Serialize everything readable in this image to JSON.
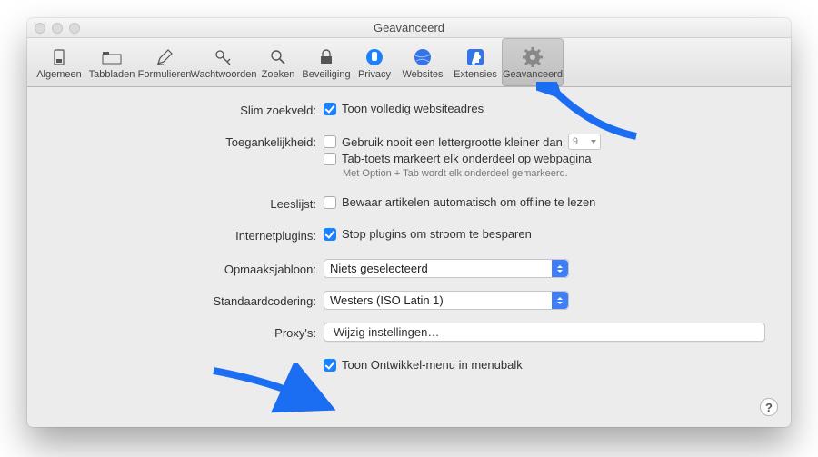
{
  "window": {
    "title": "Geavanceerd"
  },
  "tabs": [
    {
      "label": "Algemeen"
    },
    {
      "label": "Tabbladen"
    },
    {
      "label": "Formulieren"
    },
    {
      "label": "Wachtwoorden"
    },
    {
      "label": "Zoeken"
    },
    {
      "label": "Beveiliging"
    },
    {
      "label": "Privacy"
    },
    {
      "label": "Websites"
    },
    {
      "label": "Extensies"
    },
    {
      "label": "Geavanceerd"
    }
  ],
  "form": {
    "smartSearch": {
      "label": "Slim zoekveld:",
      "opt1": "Toon volledig websiteadres"
    },
    "accessibility": {
      "label": "Toegankelijkheid:",
      "opt1": "Gebruik nooit een lettergrootte kleiner dan",
      "fontsize": "9",
      "opt2": "Tab-toets markeert elk onderdeel op webpagina",
      "hint": "Met Option + Tab wordt elk onderdeel gemarkeerd."
    },
    "readingList": {
      "label": "Leeslijst:",
      "opt1": "Bewaar artikelen automatisch om offline te lezen"
    },
    "plugins": {
      "label": "Internetplugins:",
      "opt1": "Stop plugins om stroom te besparen"
    },
    "stylesheet": {
      "label": "Opmaaksjabloon:",
      "value": "Niets geselecteerd"
    },
    "encoding": {
      "label": "Standaardcodering:",
      "value": "Westers (ISO Latin 1)"
    },
    "proxy": {
      "label": "Proxy's:",
      "button": "Wijzig instellingen…"
    },
    "develop": {
      "label": "Toon Ontwikkel-menu in menubalk"
    }
  },
  "help": "?"
}
